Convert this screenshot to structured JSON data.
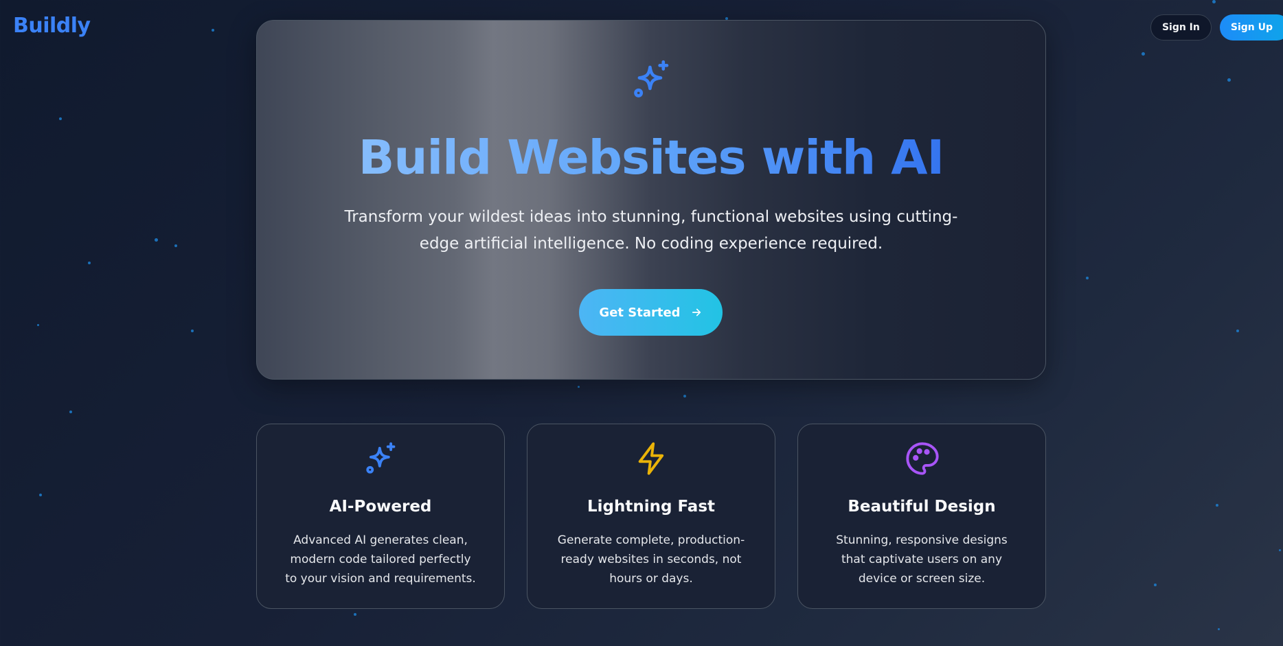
{
  "header": {
    "logo": "Buildly",
    "sign_in_label": "Sign In",
    "sign_up_label": "Sign Up"
  },
  "hero": {
    "icon": "sparkles-icon",
    "title": "Build Websites with AI",
    "subtitle": "Transform your wildest ideas into stunning, functional websites using cutting-edge artificial intelligence. No coding experience required.",
    "cta_label": "Get Started",
    "cta_icon": "arrow-right-icon"
  },
  "features": [
    {
      "icon": "sparkles-icon",
      "icon_color": "#3b82f6",
      "title": "AI-Powered",
      "description": "Advanced AI generates clean, modern code tailored perfectly to your vision and requirements."
    },
    {
      "icon": "lightning-icon",
      "icon_color": "#eab308",
      "title": "Lightning Fast",
      "description": "Generate complete, production-ready websites in seconds, not hours or days."
    },
    {
      "icon": "palette-icon",
      "icon_color": "#a855f7",
      "title": "Beautiful Design",
      "description": "Stunning, responsive designs that captivate users on any device or screen size."
    }
  ],
  "colors": {
    "accent": "#3b82f6",
    "cta_gradient_start": "#4db5f5",
    "cta_gradient_end": "#22c3e4"
  }
}
